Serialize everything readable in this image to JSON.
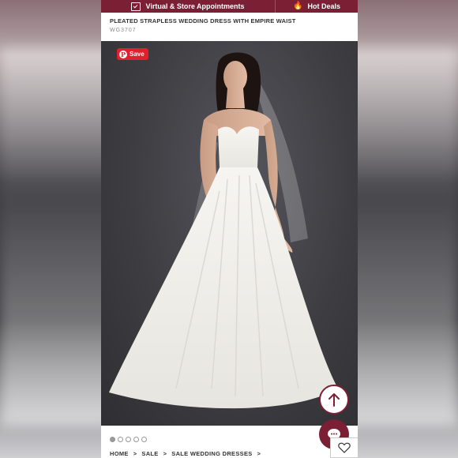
{
  "topbar": {
    "appointments_label": "Virtual & Store Appointments",
    "deals_label": "Hot Deals"
  },
  "product": {
    "title": "PLEATED STRAPLESS WEDDING DRESS WITH EMPIRE WAIST",
    "sku": "WG3707"
  },
  "image": {
    "save_label": "Save",
    "dots": [
      true,
      false,
      false,
      false,
      false
    ]
  },
  "breadcrumb": [
    "HOME",
    "SALE",
    "SALE WEDDING DRESSES"
  ],
  "icons": {
    "appointments": "calendar-check-icon",
    "deals": "fire-icon",
    "save": "pinterest-icon",
    "scroll_top": "arrow-up-icon",
    "chat": "chat-bubble-icon",
    "favorite": "heart-icon"
  },
  "colors": {
    "brand": "#7b1f35",
    "pinterest": "#e0202d"
  }
}
